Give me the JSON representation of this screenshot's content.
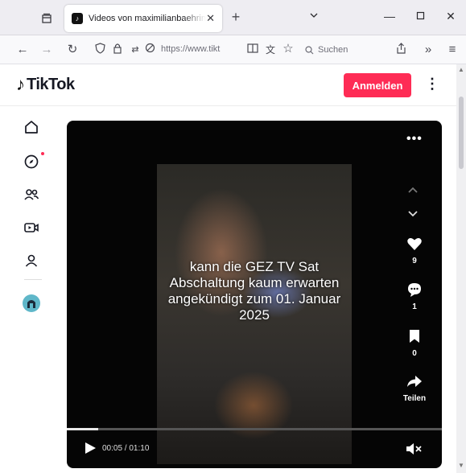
{
  "browser": {
    "tab_title": "Videos von maximilianbaehring",
    "tab_favicon": "tiktok-icon",
    "address_text": "https://www.tikt",
    "search_placeholder": "Suchen",
    "new_tab_icon": "plus-icon"
  },
  "header": {
    "logo_text": "TikTok",
    "login_label": "Anmelden",
    "accent_color": "#fe2c55"
  },
  "sidebar": {
    "items": [
      {
        "name": "home-icon"
      },
      {
        "name": "explore-icon",
        "has_notification_dot": true
      },
      {
        "name": "following-icon"
      },
      {
        "name": "live-icon"
      },
      {
        "name": "profile-icon"
      }
    ],
    "badge_icon": "channel-badge-icon"
  },
  "video": {
    "overlay_text": "kann die GEZ TV Sat Abschaltung kaum erwarten angekündigt zum 01. Januar 2025",
    "likes": "9",
    "comments": "1",
    "saves": "0",
    "share_label": "Teilen",
    "time": "00:05 / 01:10",
    "progress_fraction": 0.083
  }
}
